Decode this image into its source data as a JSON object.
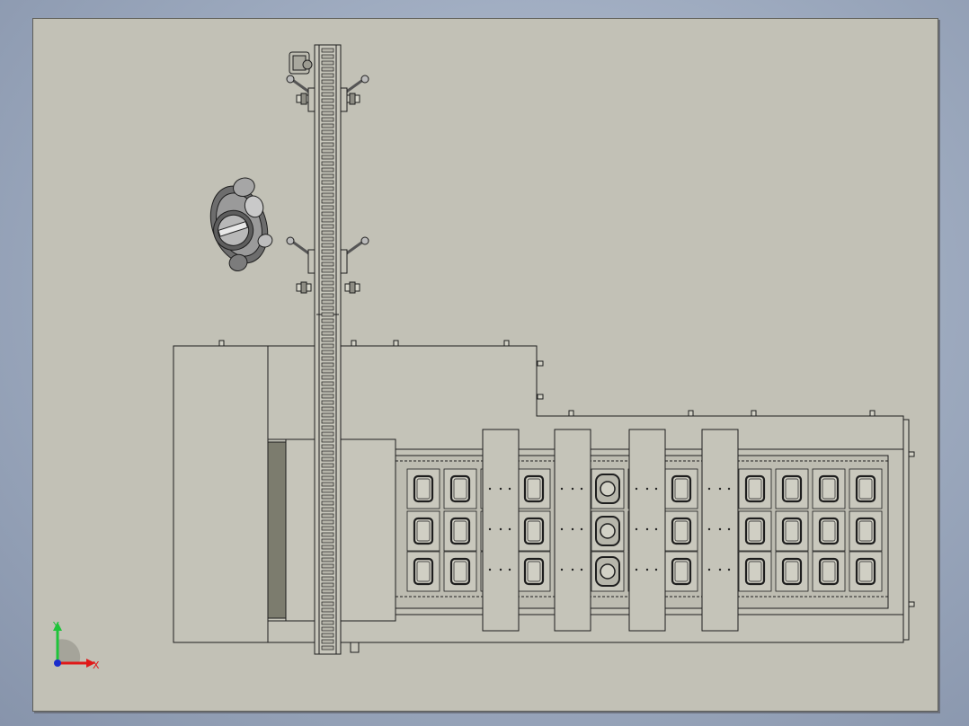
{
  "view": {
    "background_top": "#b9c4d6",
    "background_bottom": "#8794ab",
    "sheet_color": "#c2c1b6",
    "line_color": "#1e1e1e"
  },
  "triad": {
    "x_label": "X",
    "y_label": "Y",
    "x_color": "#e01818",
    "y_color": "#1ec43a",
    "z_color": "#1a2ccc"
  },
  "machine": {
    "conveyor_vertical": "chain-conveyor",
    "robot": "robot-arm",
    "tray_columns": 13,
    "tray_rows": 3,
    "press_stations": 4
  }
}
